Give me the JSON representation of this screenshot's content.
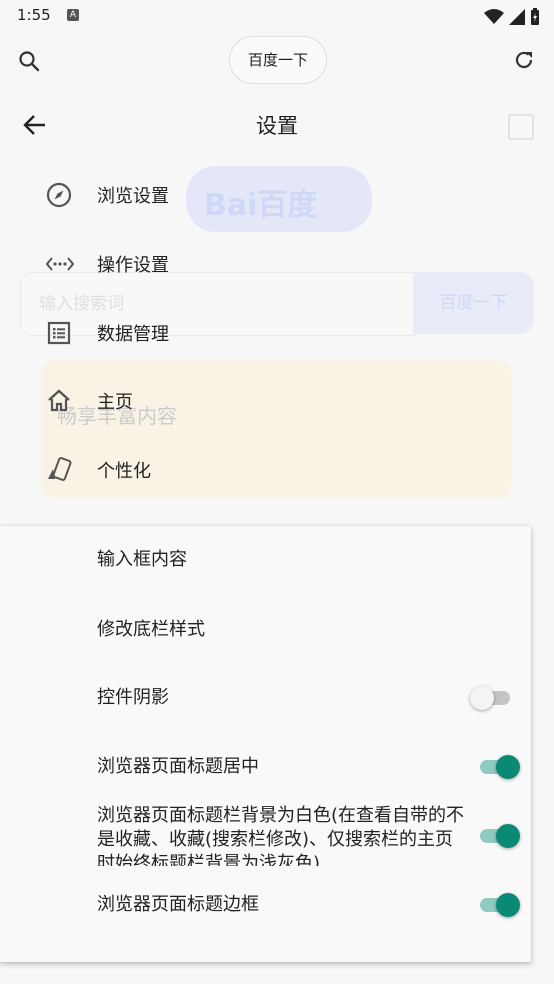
{
  "status_bar": {
    "time": "1:55",
    "a_badge": "A"
  },
  "top_bar": {
    "search_pill_label": "百度一下"
  },
  "background_page": {
    "logo_text": "Bai百度",
    "search_placeholder": "输入搜索词",
    "search_button": "百度一下",
    "card_text": "畅享丰富内容"
  },
  "settings": {
    "title": "设置",
    "items": [
      {
        "label": "浏览设置",
        "icon": "compass-icon"
      },
      {
        "label": "操作设置",
        "icon": "code-dots-icon"
      },
      {
        "label": "数据管理",
        "icon": "list-box-icon"
      },
      {
        "label": "主页",
        "icon": "home-icon"
      },
      {
        "label": "个性化",
        "icon": "palette-card-icon"
      }
    ]
  },
  "sheet": {
    "rows": [
      {
        "label": "输入框内容"
      },
      {
        "label": "修改底栏样式"
      },
      {
        "label": "控件阴影",
        "toggle": false
      },
      {
        "label": "浏览器页面标题居中",
        "toggle": true
      },
      {
        "label": "浏览器页面标题栏背景为白色(在查看自带的不是收藏、收藏(搜索栏修改)、仅搜索栏的主页时始终标题栏背景为浅灰色)",
        "toggle": true
      },
      {
        "label": "浏览器页面标题边框",
        "toggle": true
      }
    ]
  },
  "colors": {
    "accent": "#0a8a74",
    "accent_track": "#8fcbbf",
    "background": "#f7f7f7"
  }
}
